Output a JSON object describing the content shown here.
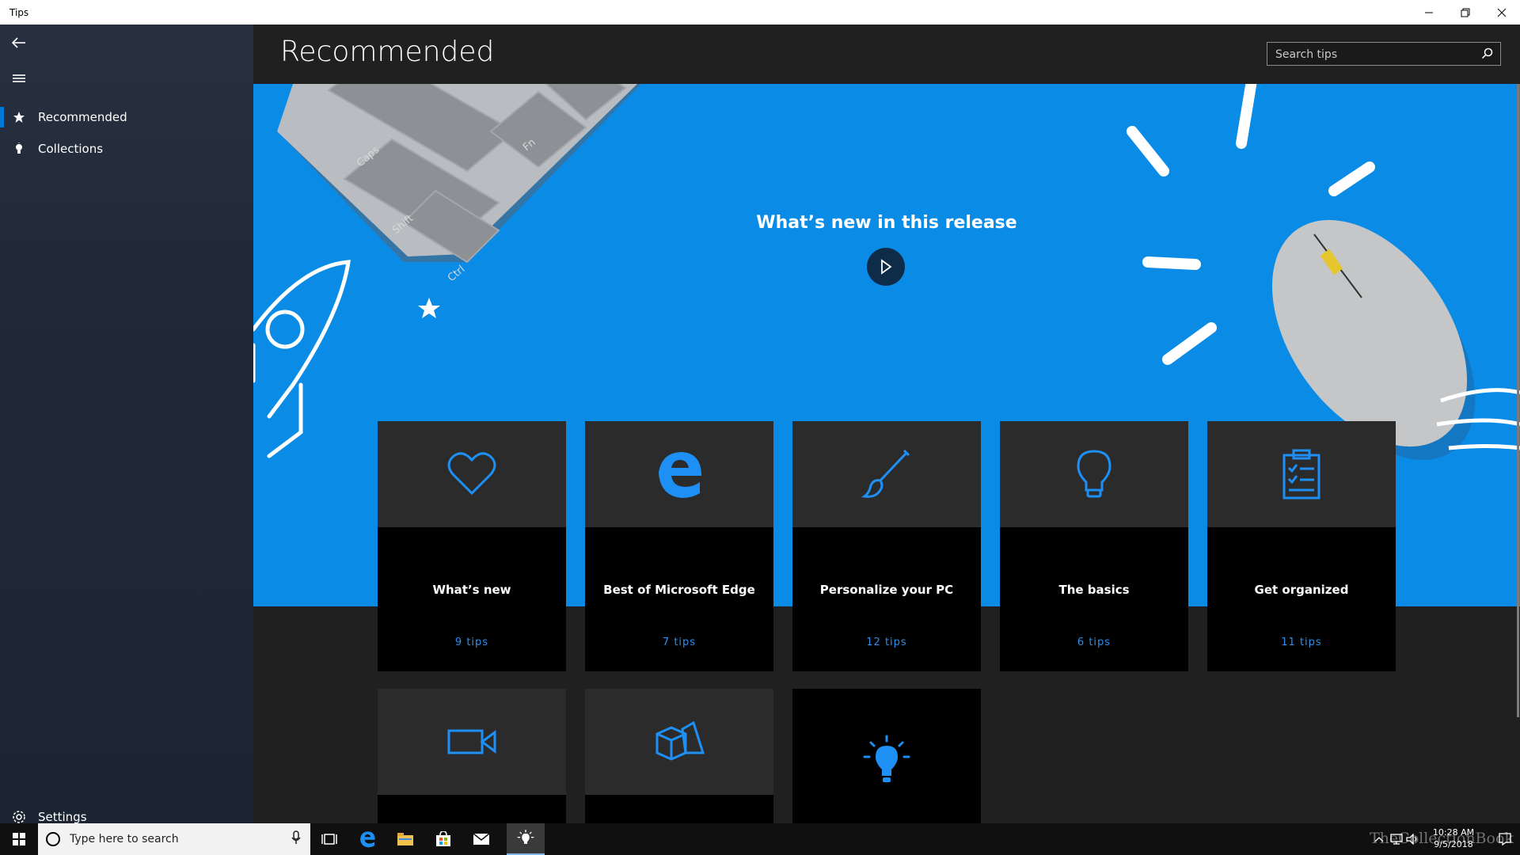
{
  "window": {
    "title": "Tips"
  },
  "sidebar": {
    "items": [
      {
        "label": "Recommended",
        "icon": "star-icon",
        "selected": true
      },
      {
        "label": "Collections",
        "icon": "lightbulb-icon",
        "selected": false
      }
    ],
    "settings_label": "Settings"
  },
  "header": {
    "title": "Recommended",
    "search_placeholder": "Search tips"
  },
  "hero": {
    "title": "What’s new in this release"
  },
  "collections": [
    {
      "title": "What’s new",
      "count": "9 tips",
      "icon": "heart-icon"
    },
    {
      "title": "Best of Microsoft Edge",
      "count": "7 tips",
      "icon": "edge-icon"
    },
    {
      "title": "Personalize your PC",
      "count": "12 tips",
      "icon": "paintbrush-icon"
    },
    {
      "title": "The basics",
      "count": "6 tips",
      "icon": "lightbulb-icon"
    },
    {
      "title": "Get organized",
      "count": "11 tips",
      "icon": "clipboard-icon"
    }
  ],
  "collections_row2": [
    {
      "icon": "video-camera-icon"
    },
    {
      "icon": "3d-shapes-icon"
    },
    {
      "icon": "lightbulb-glow-icon"
    }
  ],
  "taskbar": {
    "search_placeholder": "Type here to search",
    "time": "10:28 AM",
    "date": "9/5/2018",
    "watermark": "TheCollectionBook"
  },
  "colors": {
    "accent": "#0078d7",
    "hero_bg": "#0a8be6",
    "icon_blue": "#1e90f5"
  }
}
